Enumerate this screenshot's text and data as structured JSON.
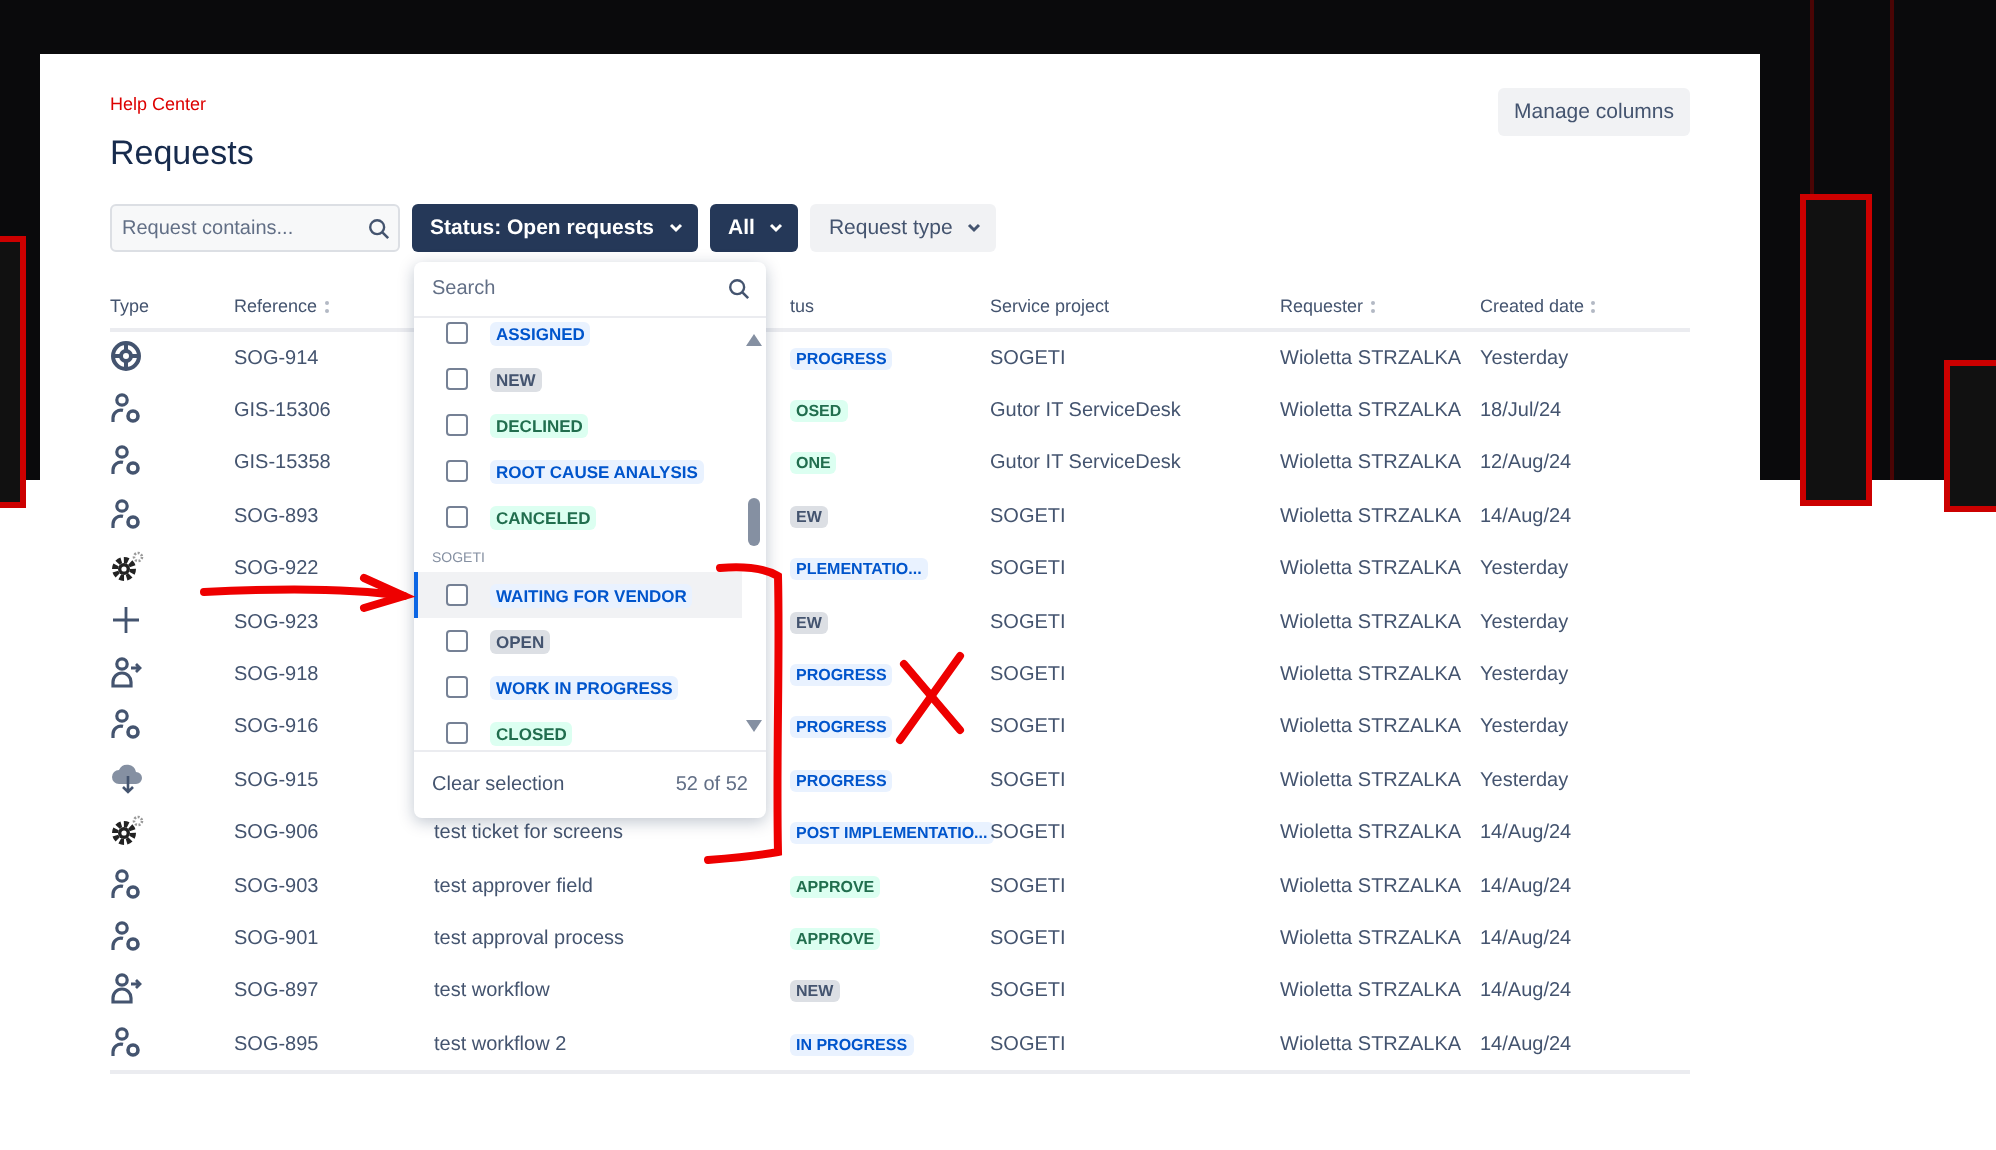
{
  "breadcrumb": "Help Center",
  "title": "Requests",
  "manage_columns": "Manage columns",
  "filters": {
    "search": {
      "placeholder": "Request contains..."
    },
    "buttons": [
      {
        "label": "Status: Open requests",
        "kind": "primary"
      },
      {
        "label": "All",
        "kind": "primary"
      },
      {
        "label": "Request type",
        "kind": "subtle"
      }
    ]
  },
  "table": {
    "columns": [
      {
        "label": "Type",
        "sortable": false
      },
      {
        "label": "Reference",
        "sortable": true
      },
      {
        "label": "tus",
        "sortable": false
      },
      {
        "label": "Service project",
        "sortable": false
      },
      {
        "label": "Requester",
        "sortable": true
      },
      {
        "label": "Created date",
        "sortable": true
      }
    ],
    "rows": [
      {
        "kind": "lifebuoy",
        "reference": "SOG-914",
        "status": "PROGRESS",
        "color": "#0055cc",
        "project": "SOGETI",
        "requester": "Wioletta STRZALKA",
        "created": "Yesterday"
      },
      {
        "kind": "person",
        "reference": "GIS-15306",
        "status": "OSED",
        "color": "#216e4e",
        "project": "Gutor IT ServiceDesk",
        "requester": "Wioletta STRZALKA",
        "created": "18/Jul/24"
      },
      {
        "kind": "person",
        "reference": "GIS-15358",
        "status": "ONE",
        "color": "#216e4e",
        "project": "Gutor IT ServiceDesk",
        "requester": "Wioletta STRZALKA",
        "created": "12/Aug/24"
      },
      {
        "kind": "person",
        "reference": "SOG-893",
        "status": "EW",
        "color": "#44546f",
        "project": "SOGETI",
        "requester": "Wioletta STRZALKA",
        "created": "14/Aug/24"
      },
      {
        "kind": "gear",
        "reference": "SOG-922",
        "status": "PLEMENTATIO...",
        "color": "#0055cc",
        "project": "SOGETI",
        "requester": "Wioletta STRZALKA",
        "created": "Yesterday"
      },
      {
        "kind": "plus",
        "reference": "SOG-923",
        "status": "EW",
        "color": "#44546f",
        "project": "SOGETI",
        "requester": "Wioletta STRZALKA",
        "created": "Yesterday"
      },
      {
        "kind": "person-arrow",
        "reference": "SOG-918",
        "status": "PROGRESS",
        "color": "#0055cc",
        "project": "SOGETI",
        "requester": "Wioletta STRZALKA",
        "created": "Yesterday"
      },
      {
        "kind": "person",
        "reference": "SOG-916",
        "status": "PROGRESS",
        "color": "#0055cc",
        "project": "SOGETI",
        "requester": "Wioletta STRZALKA",
        "created": "Yesterday"
      },
      {
        "kind": "cloud",
        "reference": "SOG-915",
        "status": "PROGRESS",
        "color": "#0055cc",
        "project": "SOGETI",
        "requester": "Wioletta STRZALKA",
        "created": "Yesterday"
      },
      {
        "kind": "gear",
        "reference": "SOG-906",
        "summary": "test ticket for screens",
        "status": "POST IMPLEMENTATIO...",
        "color": "#0055cc",
        "project": "SOGETI",
        "requester": "Wioletta STRZALKA",
        "created": "14/Aug/24"
      },
      {
        "kind": "person",
        "reference": "SOG-903",
        "summary": "test approver field",
        "status": "APPROVE",
        "color": "#216e4e",
        "project": "SOGETI",
        "requester": "Wioletta STRZALKA",
        "created": "14/Aug/24"
      },
      {
        "kind": "person",
        "reference": "SOG-901",
        "summary": "test approval process",
        "status": "APPROVE",
        "color": "#216e4e",
        "project": "SOGETI",
        "requester": "Wioletta STRZALKA",
        "created": "14/Aug/24"
      },
      {
        "kind": "person-arrow",
        "reference": "SOG-897",
        "summary": "test workflow",
        "status": "NEW",
        "color": "#44546f",
        "project": "SOGETI",
        "requester": "Wioletta STRZALKA",
        "created": "14/Aug/24"
      },
      {
        "kind": "person",
        "reference": "SOG-895",
        "summary": "test workflow 2",
        "status": "IN PROGRESS",
        "color": "#0055cc",
        "project": "SOGETI",
        "requester": "Wioletta STRZALKA",
        "created": "14/Aug/24"
      }
    ]
  },
  "status_dropdown": {
    "search": {
      "placeholder": "Search"
    },
    "groups": [
      {
        "items": [
          {
            "label": "ASSIGNED",
            "color": "#0055cc",
            "checked": false,
            "focused": false
          },
          {
            "label": "NEW",
            "color": "#44546f",
            "checked": false,
            "focused": false
          },
          {
            "label": "DECLINED",
            "color": "#216e4e",
            "checked": false,
            "focused": false
          },
          {
            "label": "ROOT CAUSE ANALYSIS",
            "color": "#0055cc",
            "checked": false,
            "focused": false
          },
          {
            "label": "CANCELED",
            "color": "#216e4e",
            "checked": false,
            "focused": false
          }
        ]
      },
      {
        "heading": "SOGETI",
        "items": [
          {
            "label": "WAITING FOR VENDOR",
            "color": "#0055cc",
            "checked": false,
            "focused": true
          },
          {
            "label": "OPEN",
            "color": "#44546f",
            "checked": false,
            "focused": false
          },
          {
            "label": "WORK IN PROGRESS",
            "color": "#0055cc",
            "checked": false,
            "focused": false
          },
          {
            "label": "CLOSED",
            "color": "#216e4e",
            "checked": false,
            "focused": false
          }
        ]
      }
    ],
    "clear": "Clear selection",
    "count": "52 of 52"
  }
}
